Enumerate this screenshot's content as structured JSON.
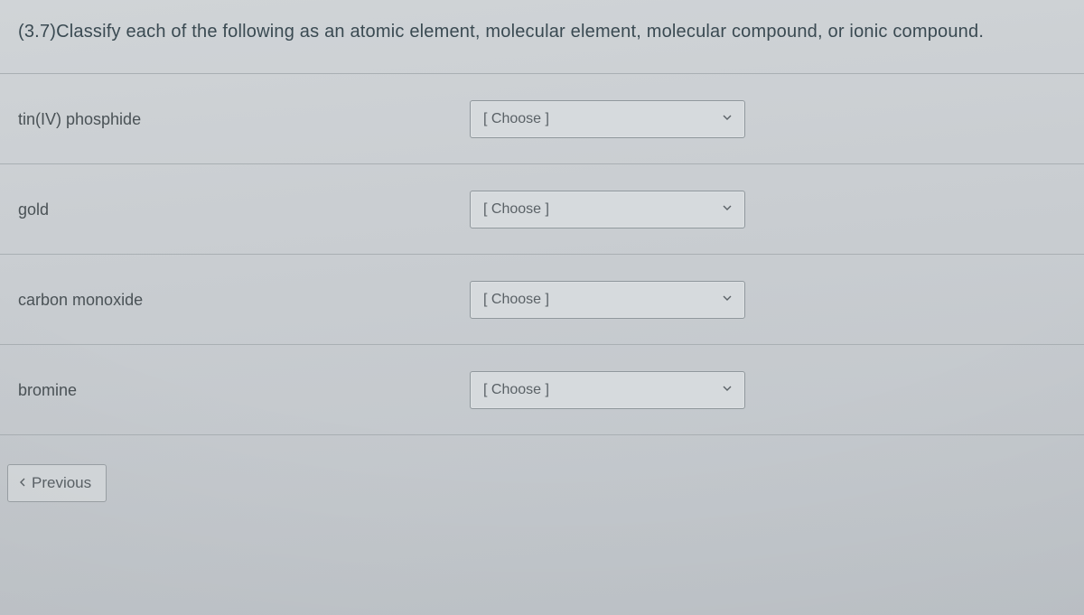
{
  "question": "(3.7)Classify each of the following as an atomic element, molecular element, molecular compound, or ionic compound.",
  "items": [
    {
      "label": "tin(IV) phosphide",
      "selected": "[ Choose ]"
    },
    {
      "label": "gold",
      "selected": "[ Choose ]"
    },
    {
      "label": "carbon monoxide",
      "selected": "[ Choose ]"
    },
    {
      "label": "bromine",
      "selected": "[ Choose ]"
    }
  ],
  "nav": {
    "previous": "Previous"
  }
}
